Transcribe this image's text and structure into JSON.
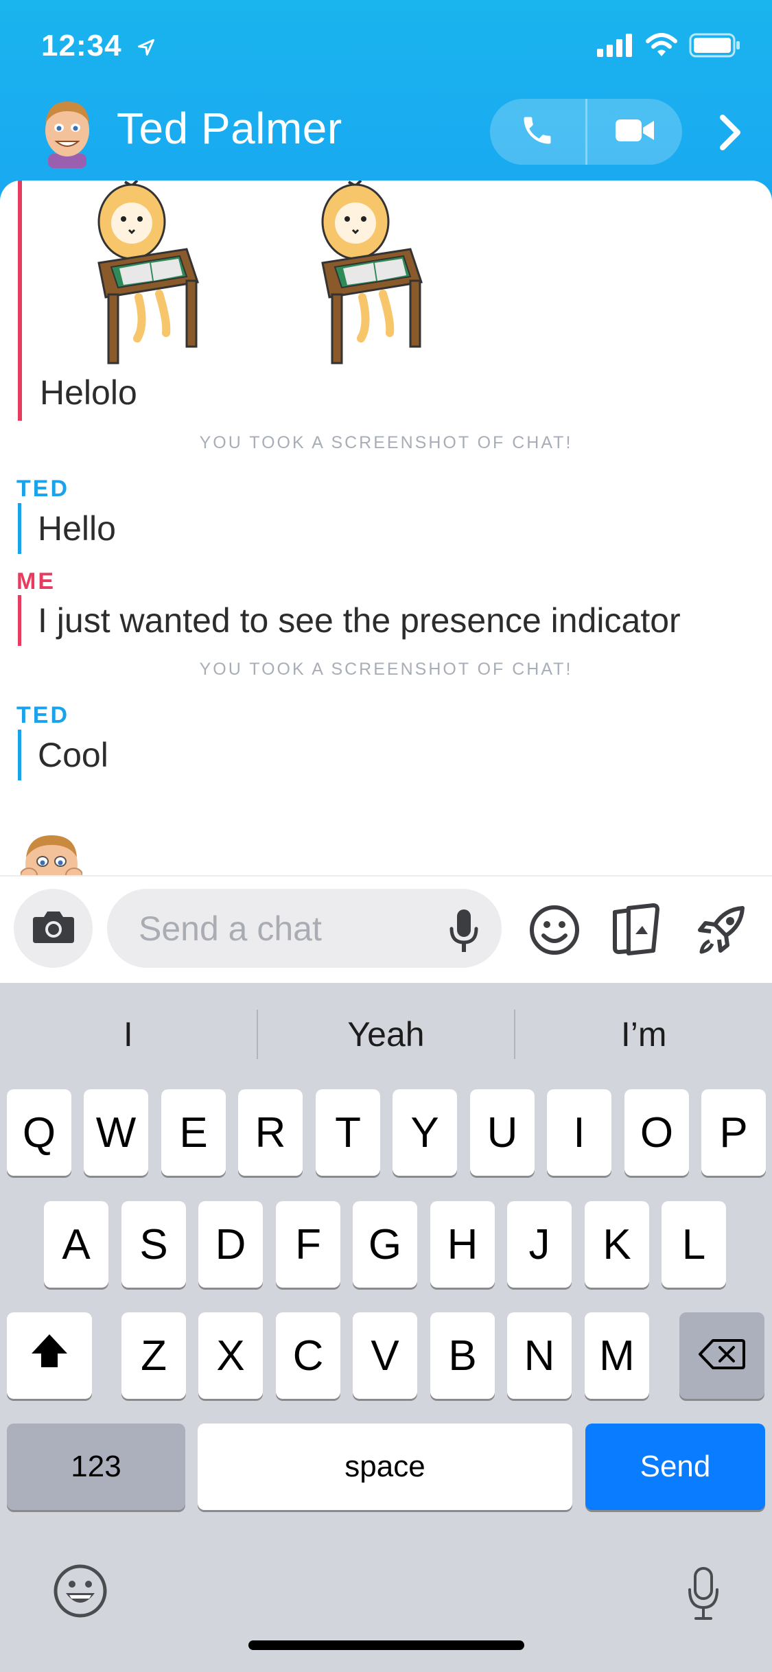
{
  "status_bar": {
    "time": "12:34"
  },
  "header": {
    "contact_name": "Ted Palmer"
  },
  "messages": {
    "sticker_caption": "Helolo",
    "notice_1": "YOU TOOK A SCREENSHOT OF CHAT!",
    "sender_ted_1": "TED",
    "ted_msg_1": "Hello",
    "sender_me": "ME",
    "me_msg_1": "I just wanted to see the presence indicator",
    "notice_2": "YOU TOOK A SCREENSHOT OF CHAT!",
    "sender_ted_2": "TED",
    "ted_msg_2": "Cool"
  },
  "input_bar": {
    "placeholder": "Send a chat"
  },
  "keyboard": {
    "suggestions": [
      "I",
      "Yeah",
      "I’m"
    ],
    "row1": [
      "Q",
      "W",
      "E",
      "R",
      "T",
      "Y",
      "U",
      "I",
      "O",
      "P"
    ],
    "row2": [
      "A",
      "S",
      "D",
      "F",
      "G",
      "H",
      "J",
      "K",
      "L"
    ],
    "row3": [
      "Z",
      "X",
      "C",
      "V",
      "B",
      "N",
      "M"
    ],
    "numbers_label": "123",
    "space_label": "space",
    "send_label": "Send"
  },
  "colors": {
    "header_blue": "#19a8f1",
    "ted_blue": "#1aa2ea",
    "me_red": "#e63c5f",
    "send_blue": "#0a7cff"
  }
}
